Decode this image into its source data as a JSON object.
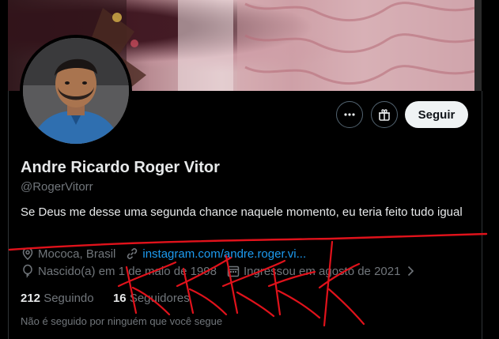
{
  "profile": {
    "name": "Andre Ricardo Roger Vitor",
    "handle": "@RogerVitorr",
    "bio": "Se Deus me desse uma segunda chance naquele momento, eu teria feito tudo igual",
    "location": "Mococa, Brasil",
    "website": "instagram.com/andre.roger.vi...",
    "birth": "Nascido(a) em 1 de maio de 1998",
    "joined": "Ingressou em agosto de 2021",
    "following_count": "212",
    "following_label": "Seguindo",
    "followers_count": "16",
    "followers_label": "Seguidores",
    "not_followed_text": "Não é seguido por ninguém que você segue"
  },
  "actions": {
    "follow_label": "Seguir"
  },
  "colors": {
    "background": "#000000",
    "link": "#1d9bf0",
    "muted": "#71767b",
    "scribble": "#e0121b"
  },
  "icons": [
    "more-icon",
    "gift-icon",
    "location-pin-icon",
    "link-icon",
    "balloon-icon",
    "calendar-icon",
    "chevron-right-icon"
  ]
}
